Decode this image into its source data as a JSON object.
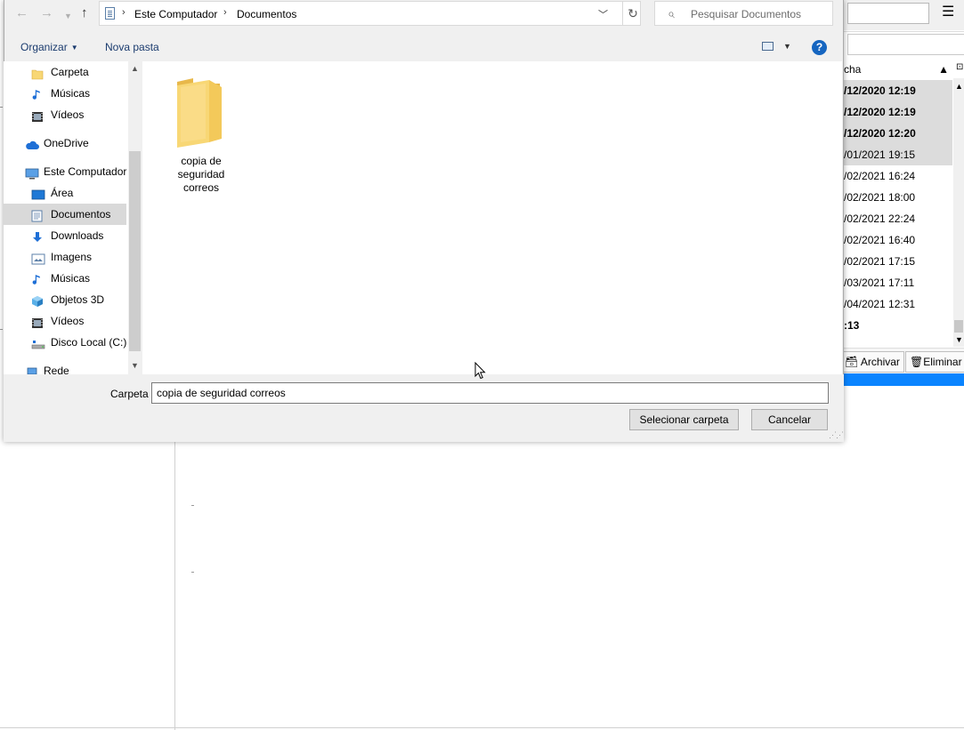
{
  "background_app": {
    "dates_header": "cha",
    "rows": [
      {
        "text": "/12/2020 12:19",
        "bold": true,
        "selected": true
      },
      {
        "text": "/12/2020 12:19",
        "bold": true,
        "selected": true
      },
      {
        "text": "/12/2020 12:20",
        "bold": true,
        "selected": true
      },
      {
        "text": "/01/2021 19:15",
        "bold": false,
        "selected": true
      },
      {
        "text": "/02/2021 16:24",
        "bold": false,
        "selected": false
      },
      {
        "text": "/02/2021 18:00",
        "bold": false,
        "selected": false
      },
      {
        "text": "/02/2021 22:24",
        "bold": false,
        "selected": false
      },
      {
        "text": "/02/2021 16:40",
        "bold": false,
        "selected": false
      },
      {
        "text": "/02/2021 17:15",
        "bold": false,
        "selected": false
      },
      {
        "text": "/03/2021 17:11",
        "bold": false,
        "selected": false
      },
      {
        "text": "/04/2021 12:31",
        "bold": false,
        "selected": false
      },
      {
        "text": ":13",
        "bold": true,
        "selected": false
      }
    ],
    "archive_button": "Archivar",
    "delete_button": "Eliminar",
    "menu_glyph": "☰"
  },
  "dialog": {
    "breadcrumb": [
      "Este Computador",
      "Documentos"
    ],
    "search_placeholder": "Pesquisar Documentos",
    "toolbar": {
      "organize": "Organizar",
      "new_folder": "Nova pasta"
    },
    "nav_items": [
      {
        "label": "Carpeta",
        "icon": "folder-icon",
        "indent": 1
      },
      {
        "label": "Músicas",
        "icon": "music-icon",
        "indent": 1
      },
      {
        "label": "Vídeos",
        "icon": "video-icon",
        "indent": 1
      },
      {
        "label": "OneDrive",
        "icon": "cloud-icon",
        "indent": 0
      },
      {
        "label": "Este Computador",
        "icon": "computer-icon",
        "indent": 0
      },
      {
        "label": "Área",
        "icon": "desktop-icon",
        "indent": 1
      },
      {
        "label": "Documentos",
        "icon": "document-icon",
        "indent": 1,
        "selected": true
      },
      {
        "label": "Downloads",
        "icon": "download-icon",
        "indent": 1
      },
      {
        "label": "Imagens",
        "icon": "image-icon",
        "indent": 1
      },
      {
        "label": "Músicas",
        "icon": "music-icon",
        "indent": 1
      },
      {
        "label": "Objetos 3D",
        "icon": "cube-icon",
        "indent": 1
      },
      {
        "label": "Vídeos",
        "icon": "video-icon",
        "indent": 1
      },
      {
        "label": "Disco Local (C:)",
        "icon": "drive-icon",
        "indent": 1
      },
      {
        "label": "Rede",
        "icon": "network-icon",
        "indent": 0
      }
    ],
    "content_items": [
      {
        "label": "copia de seguridad correos",
        "icon": "folder-icon"
      }
    ],
    "folder_field_label": "Carpeta",
    "folder_field_value": "copia de seguridad correos",
    "select_button": "Selecionar carpeta",
    "cancel_button": "Cancelar"
  },
  "colors": {
    "accent": "#0a84ff",
    "folder_yellow": "#f8d775",
    "selection_gray": "#d9d9d9"
  }
}
